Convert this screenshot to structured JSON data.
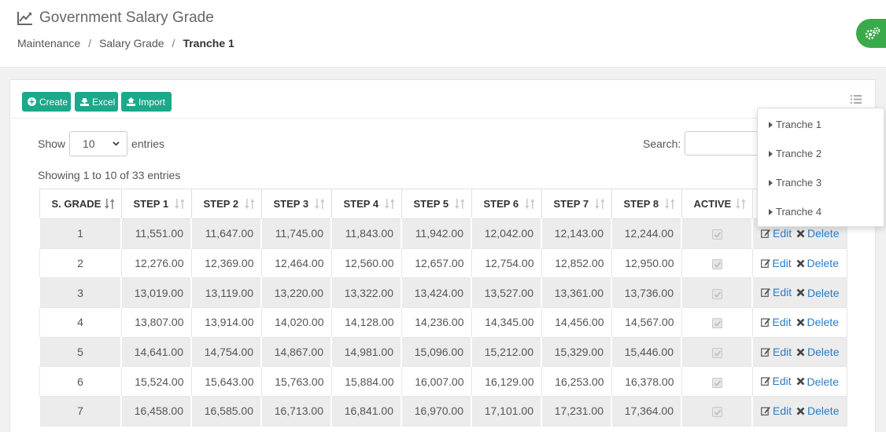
{
  "header": {
    "title": "Government Salary Grade",
    "title_icon": "line-chart-icon",
    "breadcrumb": [
      "Maintenance",
      "Salary Grade",
      "Tranche 1"
    ],
    "breadcrumb_separator": "/"
  },
  "colors": {
    "primary": "#1aa98a",
    "settings": "#3aaa4b",
    "link": "#2a7cc7"
  },
  "toolbar": {
    "create_label": "Create",
    "excel_label": "Excel",
    "import_label": "Import"
  },
  "controls": {
    "show_label": "Show",
    "entries_value": "10",
    "entries_label": "entries",
    "search_label": "Search:",
    "info": "Showing 1 to 10 of 33 entries"
  },
  "table": {
    "columns": [
      "S. GRADE",
      "STEP 1",
      "STEP 2",
      "STEP 3",
      "STEP 4",
      "STEP 5",
      "STEP 6",
      "STEP 7",
      "STEP 8",
      "ACTIVE",
      ""
    ],
    "rows": [
      {
        "grade": "1",
        "steps": [
          "11,551.00",
          "11,647.00",
          "11,745.00",
          "11,843.00",
          "11,942.00",
          "12,042.00",
          "12,143.00",
          "12,244.00"
        ],
        "active": true
      },
      {
        "grade": "2",
        "steps": [
          "12,276.00",
          "12,369.00",
          "12,464.00",
          "12,560.00",
          "12,657.00",
          "12,754.00",
          "12,852.00",
          "12,950.00"
        ],
        "active": true
      },
      {
        "grade": "3",
        "steps": [
          "13,019.00",
          "13,119.00",
          "13,220.00",
          "13,322.00",
          "13,424.00",
          "13,527.00",
          "13,361.00",
          "13,736.00"
        ],
        "active": true
      },
      {
        "grade": "4",
        "steps": [
          "13,807.00",
          "13,914.00",
          "14,020.00",
          "14,128.00",
          "14,236.00",
          "14,345.00",
          "14,456.00",
          "14,567.00"
        ],
        "active": true
      },
      {
        "grade": "5",
        "steps": [
          "14,641.00",
          "14,754.00",
          "14,867.00",
          "14,981.00",
          "15,096.00",
          "15,212.00",
          "15,329.00",
          "15,446.00"
        ],
        "active": true
      },
      {
        "grade": "6",
        "steps": [
          "15,524.00",
          "15,643.00",
          "15,763.00",
          "15,884.00",
          "16,007.00",
          "16,129.00",
          "16,253.00",
          "16,378.00"
        ],
        "active": true
      },
      {
        "grade": "7",
        "steps": [
          "16,458.00",
          "16,585.00",
          "16,713.00",
          "16,841.00",
          "16,970.00",
          "17,101.00",
          "17,231.00",
          "17,364.00"
        ],
        "active": true
      }
    ],
    "edit_label": "Edit",
    "delete_label": "Delete"
  },
  "dropdown": {
    "items": [
      "Tranche 1",
      "Tranche 2",
      "Tranche 3",
      "Tranche 4"
    ]
  }
}
